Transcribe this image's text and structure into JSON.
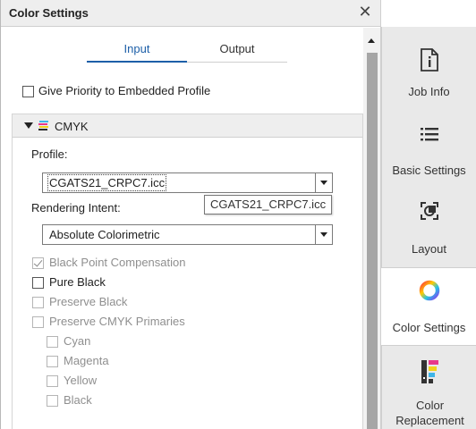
{
  "panel": {
    "title": "Color Settings",
    "close_glyph": "✕",
    "tabs": [
      {
        "label": "Input",
        "active": true
      },
      {
        "label": "Output",
        "active": false
      }
    ],
    "priority_checkbox": {
      "label": "Give Priority to Embedded Profile",
      "checked": false
    },
    "section": {
      "title": "CMYK",
      "expanded": true,
      "profile": {
        "label": "Profile:",
        "value": "CGATS21_CRPC7.icc",
        "tooltip": "CGATS21_CRPC7.icc"
      },
      "rendering_intent": {
        "label": "Rendering Intent:",
        "value": "Absolute Colorimetric"
      },
      "options": [
        {
          "label": "Black Point Compensation",
          "checked": true,
          "enabled": false
        },
        {
          "label": "Pure Black",
          "checked": false,
          "enabled": true
        },
        {
          "label": "Preserve Black",
          "checked": false,
          "enabled": false
        },
        {
          "label": "Preserve CMYK Primaries",
          "checked": false,
          "enabled": false
        }
      ],
      "primaries": [
        {
          "label": "Cyan",
          "checked": false,
          "enabled": false
        },
        {
          "label": "Magenta",
          "checked": false,
          "enabled": false
        },
        {
          "label": "Yellow",
          "checked": false,
          "enabled": false
        },
        {
          "label": "Black",
          "checked": false,
          "enabled": false
        }
      ]
    }
  },
  "nav": {
    "items": [
      {
        "label": "Job Info",
        "icon": "job-info-icon"
      },
      {
        "label": "Basic Settings",
        "icon": "list-icon"
      },
      {
        "label": "Layout",
        "icon": "layout-icon"
      },
      {
        "label": "Color Settings",
        "icon": "color-wheel-icon",
        "active": true
      },
      {
        "label": "Color Replacement",
        "label_line1": "Color",
        "label_line2": "Replacement",
        "icon": "color-replacement-icon"
      }
    ]
  },
  "colors": {
    "accent": "#1d5fa8",
    "nav_bg": "#e9e9e9",
    "header_bg": "#eeeeee"
  }
}
